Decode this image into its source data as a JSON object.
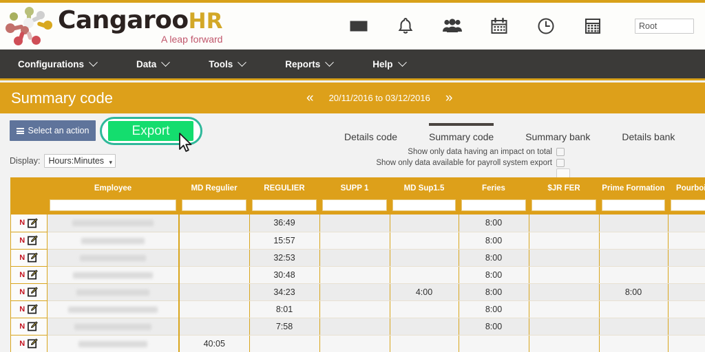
{
  "brand": {
    "name_main": "Cangaroo",
    "name_accent": "HR",
    "tagline": "A leap forward",
    "logo_icon": "cangaroo-dots-logo"
  },
  "header": {
    "icons": [
      {
        "name": "inbox-icon",
        "label": "Inbox"
      },
      {
        "name": "bell-icon",
        "label": "Notifications"
      },
      {
        "name": "people-icon",
        "label": "Employees"
      },
      {
        "name": "calendar-icon",
        "label": "Calendar"
      },
      {
        "name": "clock-icon",
        "label": "Time"
      },
      {
        "name": "calculator-icon",
        "label": "Calculator"
      }
    ],
    "root_field_value": "Root",
    "root_field_placeholder": "Root"
  },
  "nav": {
    "items": [
      {
        "label": "Configurations",
        "icon": "chevron-down-icon"
      },
      {
        "label": "Data",
        "icon": "chevron-down-icon"
      },
      {
        "label": "Tools",
        "icon": "chevron-down-icon"
      },
      {
        "label": "Reports",
        "icon": "chevron-down-icon"
      },
      {
        "label": "Help",
        "icon": "chevron-down-icon"
      }
    ]
  },
  "titlebar": {
    "title": "Summary code",
    "prev_icon": "«",
    "next_icon": "»",
    "period": "20/11/2016 to 03/12/2016",
    "background_color": "#dda01a"
  },
  "toolbar": {
    "select_action_label": "Select an action",
    "select_action_icon": "hamburger-icon",
    "export_label": "Export",
    "export_color": "#14dd6e",
    "export_highlight_color": "#2fb89a",
    "display_label": "Display:",
    "display_value": "Hours:Minutes",
    "display_caret": "▾"
  },
  "tabs": [
    {
      "label": "Details code",
      "active": false
    },
    {
      "label": "Summary code",
      "active": true
    },
    {
      "label": "Summary bank",
      "active": false
    },
    {
      "label": "Details bank",
      "active": false
    }
  ],
  "checkboxes": [
    {
      "label": "Show only data having an impact on total",
      "checked": false
    },
    {
      "label": "Show only data available for payroll system export",
      "checked": false
    }
  ],
  "table": {
    "columns": [
      {
        "key": "actions",
        "label": ""
      },
      {
        "key": "employee",
        "label": "Employee"
      },
      {
        "key": "md_regulier",
        "label": "MD Regulier"
      },
      {
        "key": "regulier",
        "label": "REGULIER"
      },
      {
        "key": "supp1",
        "label": "SUPP 1"
      },
      {
        "key": "md_sup15",
        "label": "MD Sup1.5"
      },
      {
        "key": "feries",
        "label": "Feries"
      },
      {
        "key": "jr_fer",
        "label": "$JR FER"
      },
      {
        "key": "prime_formation",
        "label": "Prime Formation"
      },
      {
        "key": "pourboire",
        "label": "Pourboir"
      }
    ],
    "filter_placeholder": "",
    "row_flag": "N",
    "row_edit_icon": "edit-pencil-icon",
    "rows": [
      {
        "employee": "",
        "name_width": 118,
        "md_regulier": "",
        "regulier": "36:49",
        "supp1": "",
        "md_sup15": "",
        "feries": "8:00",
        "jr_fer": "",
        "prime_formation": "",
        "pourboire": ""
      },
      {
        "employee": "",
        "name_width": 92,
        "md_regulier": "",
        "regulier": "15:57",
        "supp1": "",
        "md_sup15": "",
        "feries": "8:00",
        "jr_fer": "",
        "prime_formation": "",
        "pourboire": ""
      },
      {
        "employee": "",
        "name_width": 96,
        "md_regulier": "",
        "regulier": "32:53",
        "supp1": "",
        "md_sup15": "",
        "feries": "8:00",
        "jr_fer": "",
        "prime_formation": "",
        "pourboire": ""
      },
      {
        "employee": "",
        "name_width": 116,
        "md_regulier": "",
        "regulier": "30:48",
        "supp1": "",
        "md_sup15": "",
        "feries": "8:00",
        "jr_fer": "",
        "prime_formation": "",
        "pourboire": ""
      },
      {
        "employee": "",
        "name_width": 106,
        "md_regulier": "",
        "regulier": "34:23",
        "supp1": "",
        "md_sup15": "4:00",
        "feries": "8:00",
        "jr_fer": "",
        "prime_formation": "8:00",
        "pourboire": ""
      },
      {
        "employee": "",
        "name_width": 130,
        "md_regulier": "",
        "regulier": "8:01",
        "supp1": "",
        "md_sup15": "",
        "feries": "8:00",
        "jr_fer": "",
        "prime_formation": "",
        "pourboire": ""
      },
      {
        "employee": "",
        "name_width": 112,
        "md_regulier": "",
        "regulier": "7:58",
        "supp1": "",
        "md_sup15": "",
        "feries": "8:00",
        "jr_fer": "",
        "prime_formation": "",
        "pourboire": ""
      },
      {
        "employee": "",
        "name_width": 100,
        "md_regulier": "40:05",
        "regulier": "",
        "supp1": "",
        "md_sup15": "",
        "feries": "",
        "jr_fer": "",
        "prime_formation": "",
        "pourboire": ""
      }
    ]
  }
}
